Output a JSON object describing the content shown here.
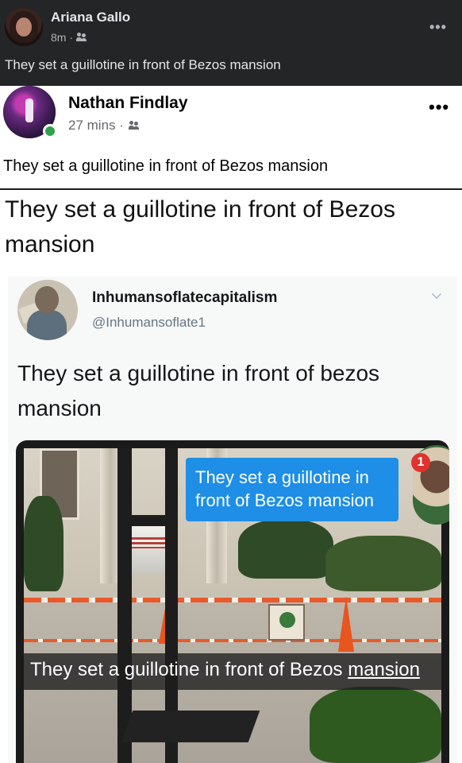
{
  "outer_post": {
    "author": "Ariana Gallo",
    "time": "8m ·",
    "audience_icon": "friends-icon",
    "more_icon": "more-dots-icon",
    "more_label": "•••",
    "text": "They set a guillotine in front of Bezos mansion"
  },
  "inner_post": {
    "author": "Nathan Findlay",
    "time": "27 mins ·",
    "audience_icon": "friends-icon",
    "more_label": "•••",
    "text": "They set a guillotine in front of Bezos mansion",
    "online_status_color": "#31a24c"
  },
  "repost_text": "They set a guillotine in front of Bezos mansion",
  "tweet": {
    "display_name": "Inhumansoflatecapitalism",
    "handle": "@Inhumansoflate1",
    "text": "They set a guillotine in front of bezos mansion"
  },
  "photo": {
    "story_bubble_text": "They set a guillotine in front of Bezos mansion",
    "notification_count": "1",
    "caption_before_underline": "They set a guillotine in front of Bezos ",
    "caption_underlined": "mansion"
  },
  "colors": {
    "dark_background": "#242526",
    "bubble_blue": "#1e8ee6",
    "badge_red": "#e0332d"
  }
}
